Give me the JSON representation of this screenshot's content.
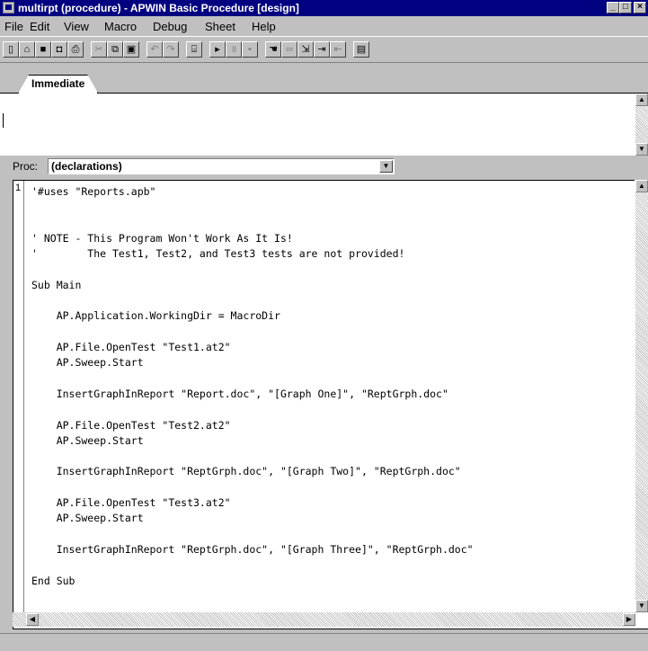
{
  "window": {
    "title": "multirpt (procedure) - APWIN Basic Procedure [design]"
  },
  "menu": [
    {
      "label": "File"
    },
    {
      "label": "Edit"
    },
    {
      "label": "View"
    },
    {
      "label": "Macro"
    },
    {
      "label": "Debug"
    },
    {
      "label": "Sheet"
    },
    {
      "label": "Help"
    }
  ],
  "toolbar": {
    "buttons": [
      "new-icon",
      "open-icon",
      "save-icon",
      "save-all-icon",
      "print-icon",
      "cut-icon",
      "copy-icon",
      "paste-icon",
      "undo-icon",
      "redo-icon",
      "dialog-editor-icon",
      "run-icon",
      "pause-icon",
      "stop-icon",
      "hand-icon",
      "watch-icon",
      "step-into-icon",
      "step-over-icon",
      "step-out-icon",
      "immediate-window-icon"
    ]
  },
  "immediate": {
    "tab_label": "Immediate"
  },
  "proc": {
    "label": "Proc:",
    "value": "(declarations)"
  },
  "editor": {
    "line_number": "1",
    "lines": [
      "'#uses \"Reports.apb\"",
      "",
      "",
      "' NOTE - This Program Won't Work As It Is!",
      "'        The Test1, Test2, and Test3 tests are not provided!",
      "",
      "Sub Main",
      "",
      "    AP.Application.WorkingDir = MacroDir",
      "",
      "    AP.File.OpenTest \"Test1.at2\"",
      "    AP.Sweep.Start",
      "",
      "    InsertGraphInReport \"Report.doc\", \"[Graph One]\", \"ReptGrph.doc\"",
      "",
      "    AP.File.OpenTest \"Test2.at2\"",
      "    AP.Sweep.Start",
      "",
      "    InsertGraphInReport \"ReptGrph.doc\", \"[Graph Two]\", \"ReptGrph.doc\"",
      "",
      "    AP.File.OpenTest \"Test3.at2\"",
      "    AP.Sweep.Start",
      "",
      "    InsertGraphInReport \"ReptGrph.doc\", \"[Graph Three]\", \"ReptGrph.doc\"",
      "",
      "End Sub"
    ]
  }
}
